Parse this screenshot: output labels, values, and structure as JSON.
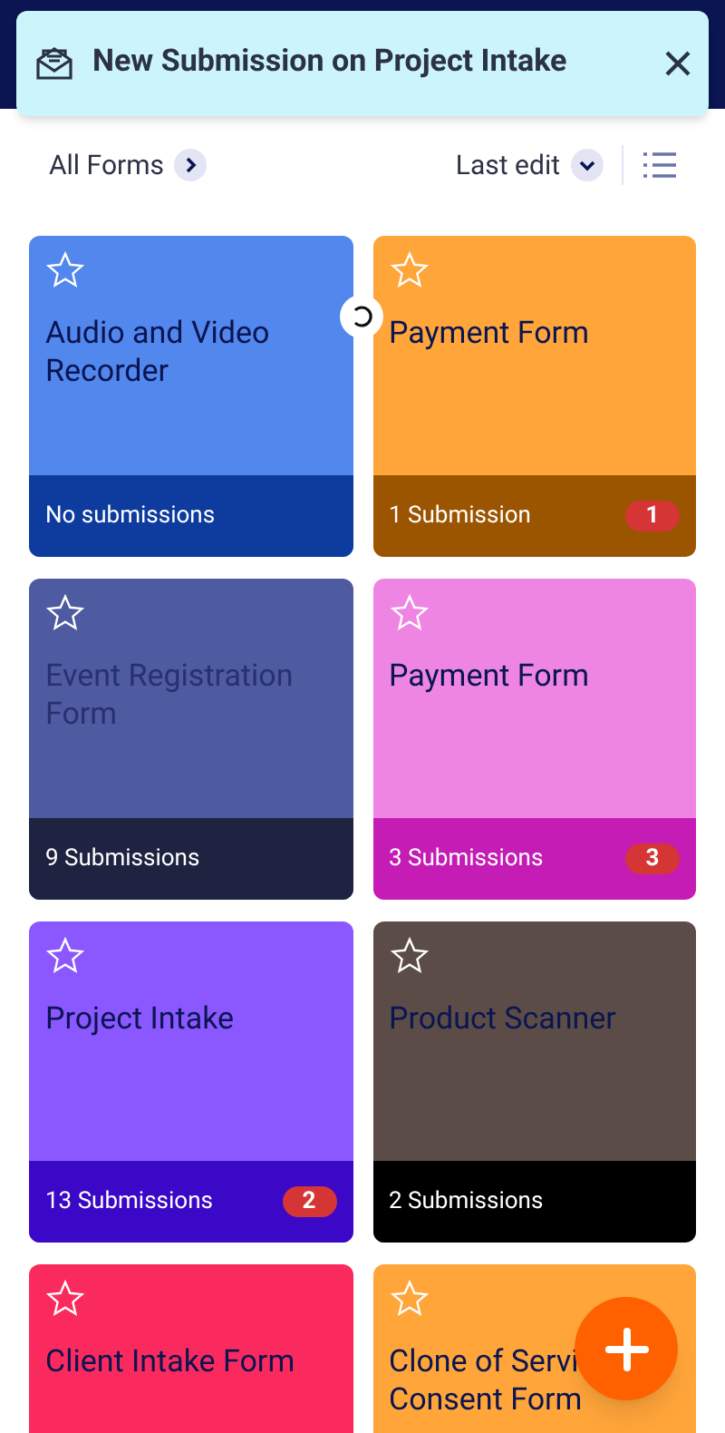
{
  "notification": {
    "title": "New Submission on Project Intake"
  },
  "toolbar": {
    "folder": "All Forms",
    "sort": "Last edit"
  },
  "forms": [
    {
      "title": "Audio and Video Recorder",
      "submissions": "No submissions",
      "color": "#5287ee",
      "favorite": false
    },
    {
      "title": "Payment Form",
      "submissions": "1 Submission",
      "badge": "1",
      "color": "#ffa53a",
      "favorite": false
    },
    {
      "title": "Event Registration Form",
      "submissions": "9 Submissions",
      "color": "#4f5ba0",
      "favorite": false
    },
    {
      "title": "Payment Form",
      "submissions": "3 Submissions",
      "badge": "3",
      "color": "#ee85e3",
      "favorite": false
    },
    {
      "title": "Project Intake",
      "submissions": "13 Submissions",
      "badge": "2",
      "color": "#8b57ff",
      "favorite": false
    },
    {
      "title": "Product Scanner",
      "submissions": "2 Submissions",
      "color": "#5c4c47",
      "favorite": false
    },
    {
      "title": "Client Intake Form",
      "color": "#fa2a5e",
      "favorite": false
    },
    {
      "title": "Clone of Servi\nConsent Form",
      "color": "#ffa53a",
      "favorite": false
    }
  ]
}
